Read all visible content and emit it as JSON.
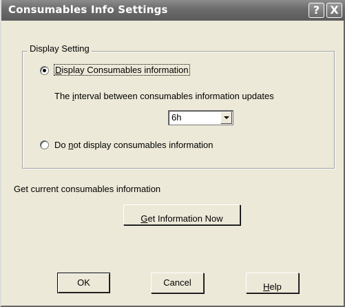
{
  "dialog": {
    "title": "Consumables Info Settings",
    "help_glyph": "?",
    "close_glyph": "X"
  },
  "display_setting": {
    "legend": "Display Setting",
    "option_display": {
      "mnemonic": "D",
      "rest": "isplay Consumables information",
      "selected": true
    },
    "interval_label": {
      "before": "The ",
      "mnemonic": "i",
      "after": "nterval between consumables information updates"
    },
    "interval_value": "6h",
    "option_hide": {
      "before": "Do ",
      "mnemonic": "n",
      "after": "ot display consumables information",
      "selected": false
    }
  },
  "current_info": {
    "label": "Get current consumables information",
    "button": {
      "mnemonic": "G",
      "rest": "et Information Now"
    }
  },
  "footer": {
    "ok": "OK",
    "cancel": "Cancel",
    "help": {
      "mnemonic": "H",
      "rest": "elp"
    }
  }
}
